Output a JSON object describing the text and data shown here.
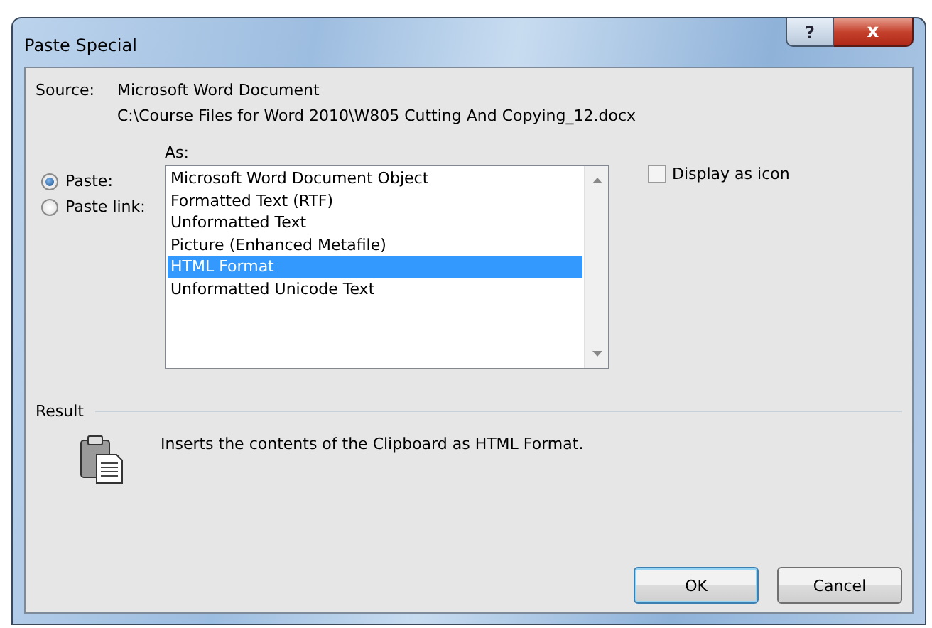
{
  "window": {
    "title": "Paste Special",
    "help_button": "?",
    "close_button": "x"
  },
  "source": {
    "label": "Source:",
    "document": "Microsoft Word Document",
    "path": "C:\\Course Files for Word 2010\\W805 Cutting And Copying_12.docx"
  },
  "as_label": "As:",
  "paste_options": [
    {
      "label": "Paste:",
      "selected": true
    },
    {
      "label": "Paste link:",
      "selected": false
    }
  ],
  "formats": [
    {
      "label": "Microsoft Word Document Object",
      "selected": false
    },
    {
      "label": "Formatted Text (RTF)",
      "selected": false
    },
    {
      "label": "Unformatted Text",
      "selected": false
    },
    {
      "label": "Picture (Enhanced Metafile)",
      "selected": false
    },
    {
      "label": "HTML Format",
      "selected": true
    },
    {
      "label": "Unformatted Unicode Text",
      "selected": false
    }
  ],
  "display_as_icon": {
    "label": "Display as icon",
    "checked": false
  },
  "result": {
    "label": "Result",
    "description": "Inserts the contents of the Clipboard as HTML Format."
  },
  "buttons": [
    {
      "label": "OK",
      "default": true
    },
    {
      "label": "Cancel",
      "default": false
    }
  ]
}
